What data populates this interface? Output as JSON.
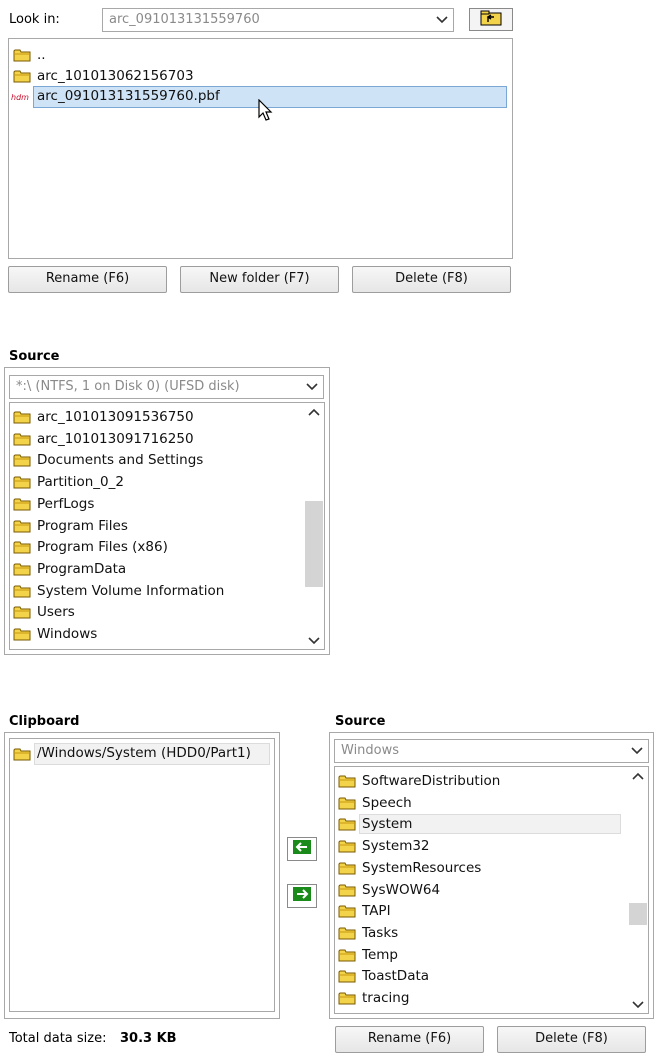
{
  "file_dialog": {
    "look_in_label": "Look in:",
    "look_in_value": "arc_091013131559760",
    "up_button_icon": "folder-up-icon",
    "items": [
      {
        "label": "..",
        "icon": "folder-icon"
      },
      {
        "label": "arc_101013062156703",
        "icon": "folder-icon"
      },
      {
        "label": "arc_091013131559760.pbf",
        "icon": "hdm-file-icon",
        "icon_text": "hdm",
        "selected": true
      }
    ],
    "buttons": {
      "rename": "Rename (F6)",
      "new_folder": "New folder (F7)",
      "delete": "Delete (F8)"
    }
  },
  "source_panel": {
    "title": "Source",
    "combo_value": "*:\\  (NTFS, 1 on Disk 0) (UFSD disk)",
    "items": [
      "arc_101013091536750",
      "arc_101013091716250",
      "Documents and Settings",
      "Partition_0_2",
      "PerfLogs",
      "Program Files",
      "Program Files (x86)",
      "ProgramData",
      "System Volume Information",
      "Users",
      "Windows"
    ],
    "scroll_position_fraction": 0.45
  },
  "clipboard_panel": {
    "title": "Clipboard",
    "items": [
      "/Windows/System (HDD0/Part1)"
    ],
    "total_label": "Total data size:",
    "total_value": "30.3 KB"
  },
  "transfer_buttons": {
    "add_icon": "arrow-left-icon",
    "remove_icon": "arrow-right-icon",
    "accent_color": "#1a8a1a"
  },
  "source_panel_2": {
    "title": "Source",
    "combo_value": "Windows",
    "items": [
      "SoftwareDistribution",
      "Speech",
      "System",
      "System32",
      "SystemResources",
      "SysWOW64",
      "TAPI",
      "Tasks",
      "Temp",
      "ToastData",
      "tracing"
    ],
    "selected_item": "System",
    "scroll_position_fraction": 0.85,
    "buttons": {
      "rename": "Rename (F6)",
      "delete": "Delete (F8)"
    }
  }
}
